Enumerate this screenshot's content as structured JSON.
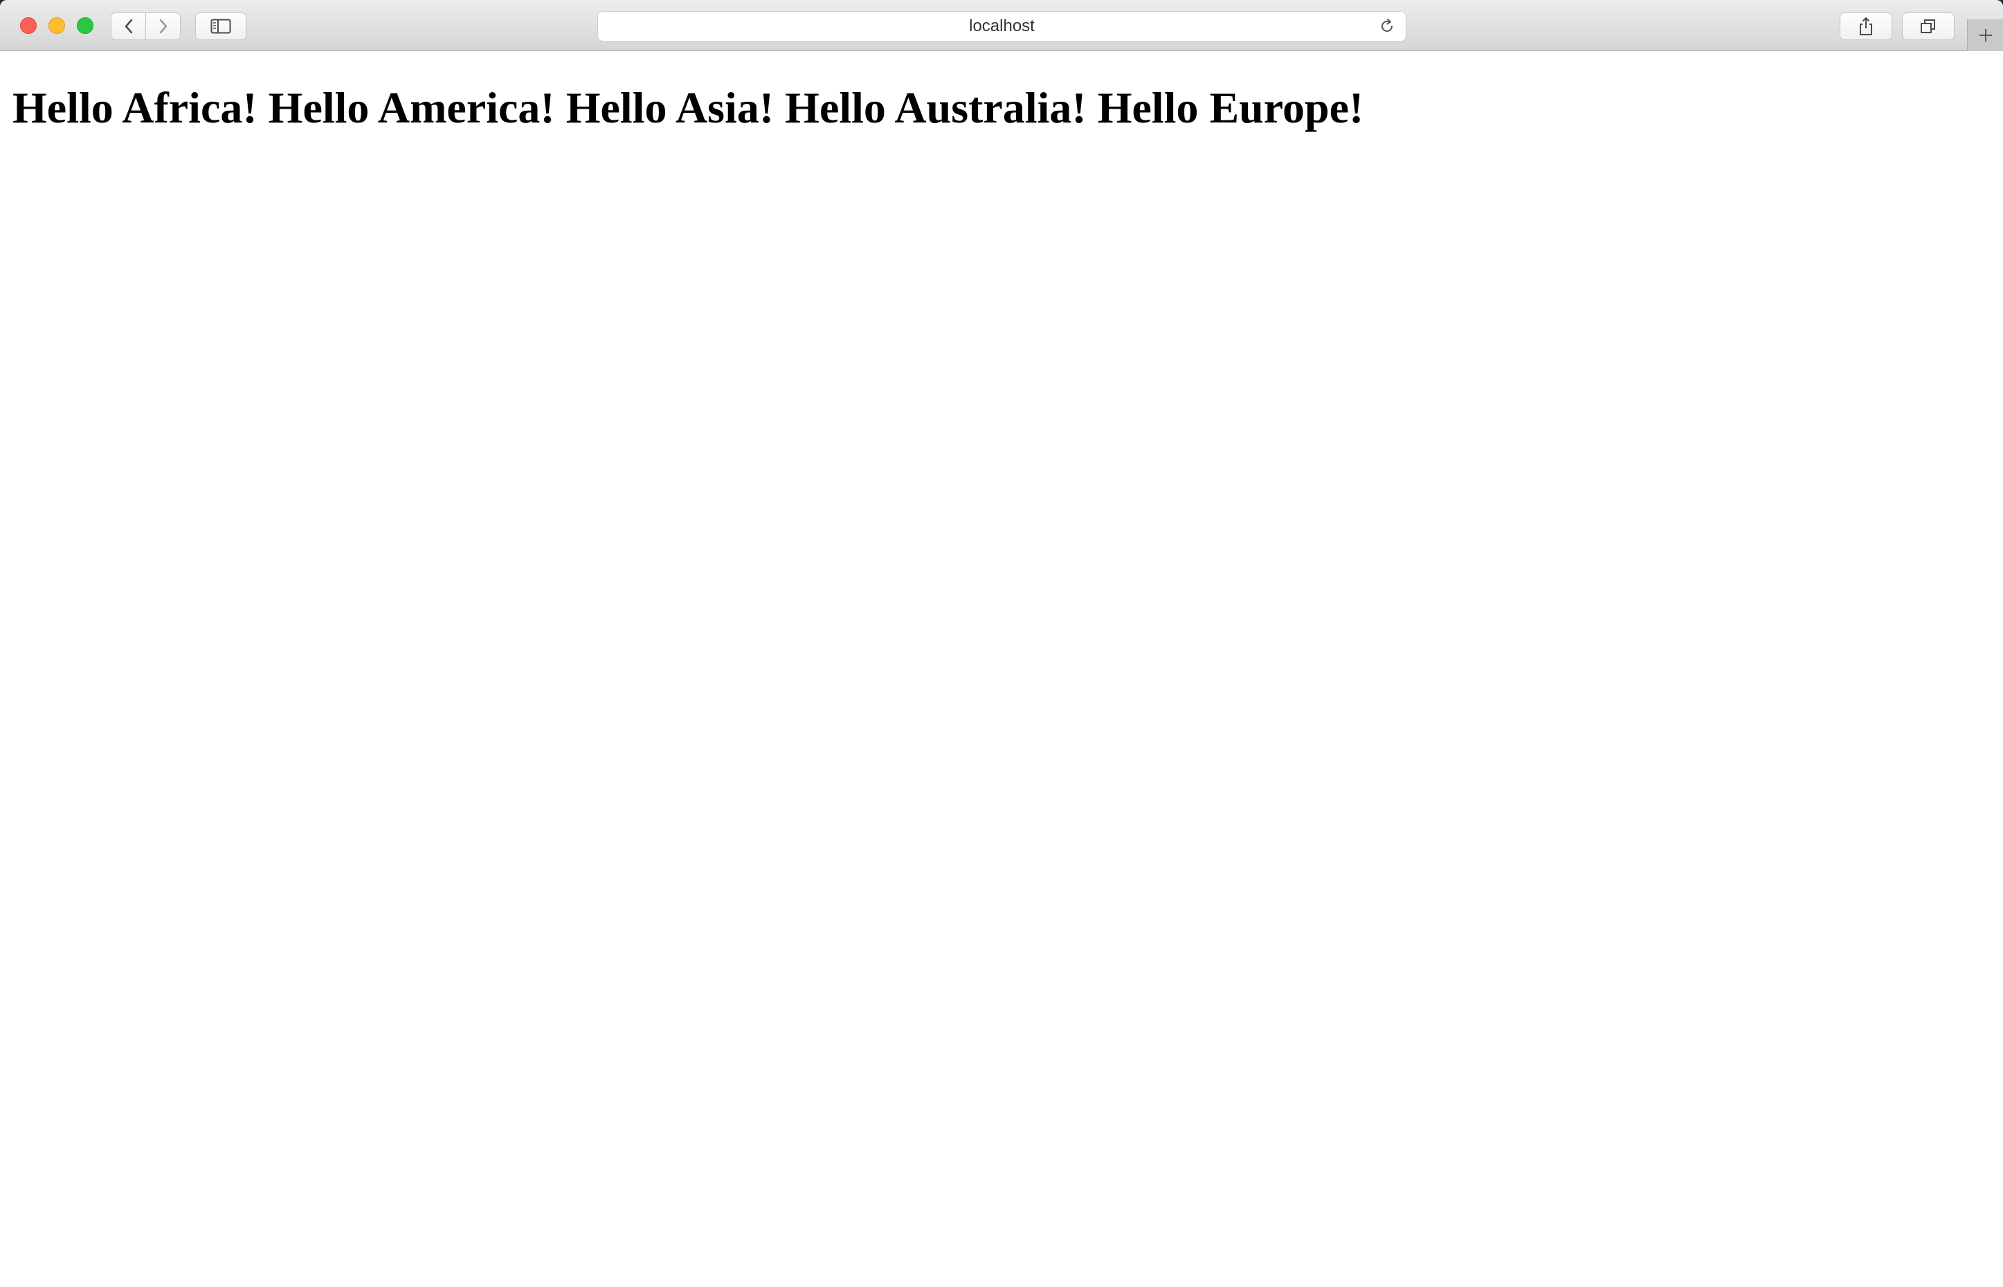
{
  "browser": {
    "url": "localhost",
    "icons": {
      "back": "chevron-left-icon",
      "forward": "chevron-right-icon",
      "sidebar": "sidebar-icon",
      "reload": "reload-icon",
      "share": "share-icon",
      "tabs": "tabs-overview-icon",
      "new_tab": "plus-icon"
    }
  },
  "page": {
    "heading": "Hello Africa! Hello America! Hello Asia! Hello Australia! Hello Europe!"
  },
  "colors": {
    "close": "#fe5f57",
    "minimize": "#febc2e",
    "maximize": "#28c840"
  }
}
